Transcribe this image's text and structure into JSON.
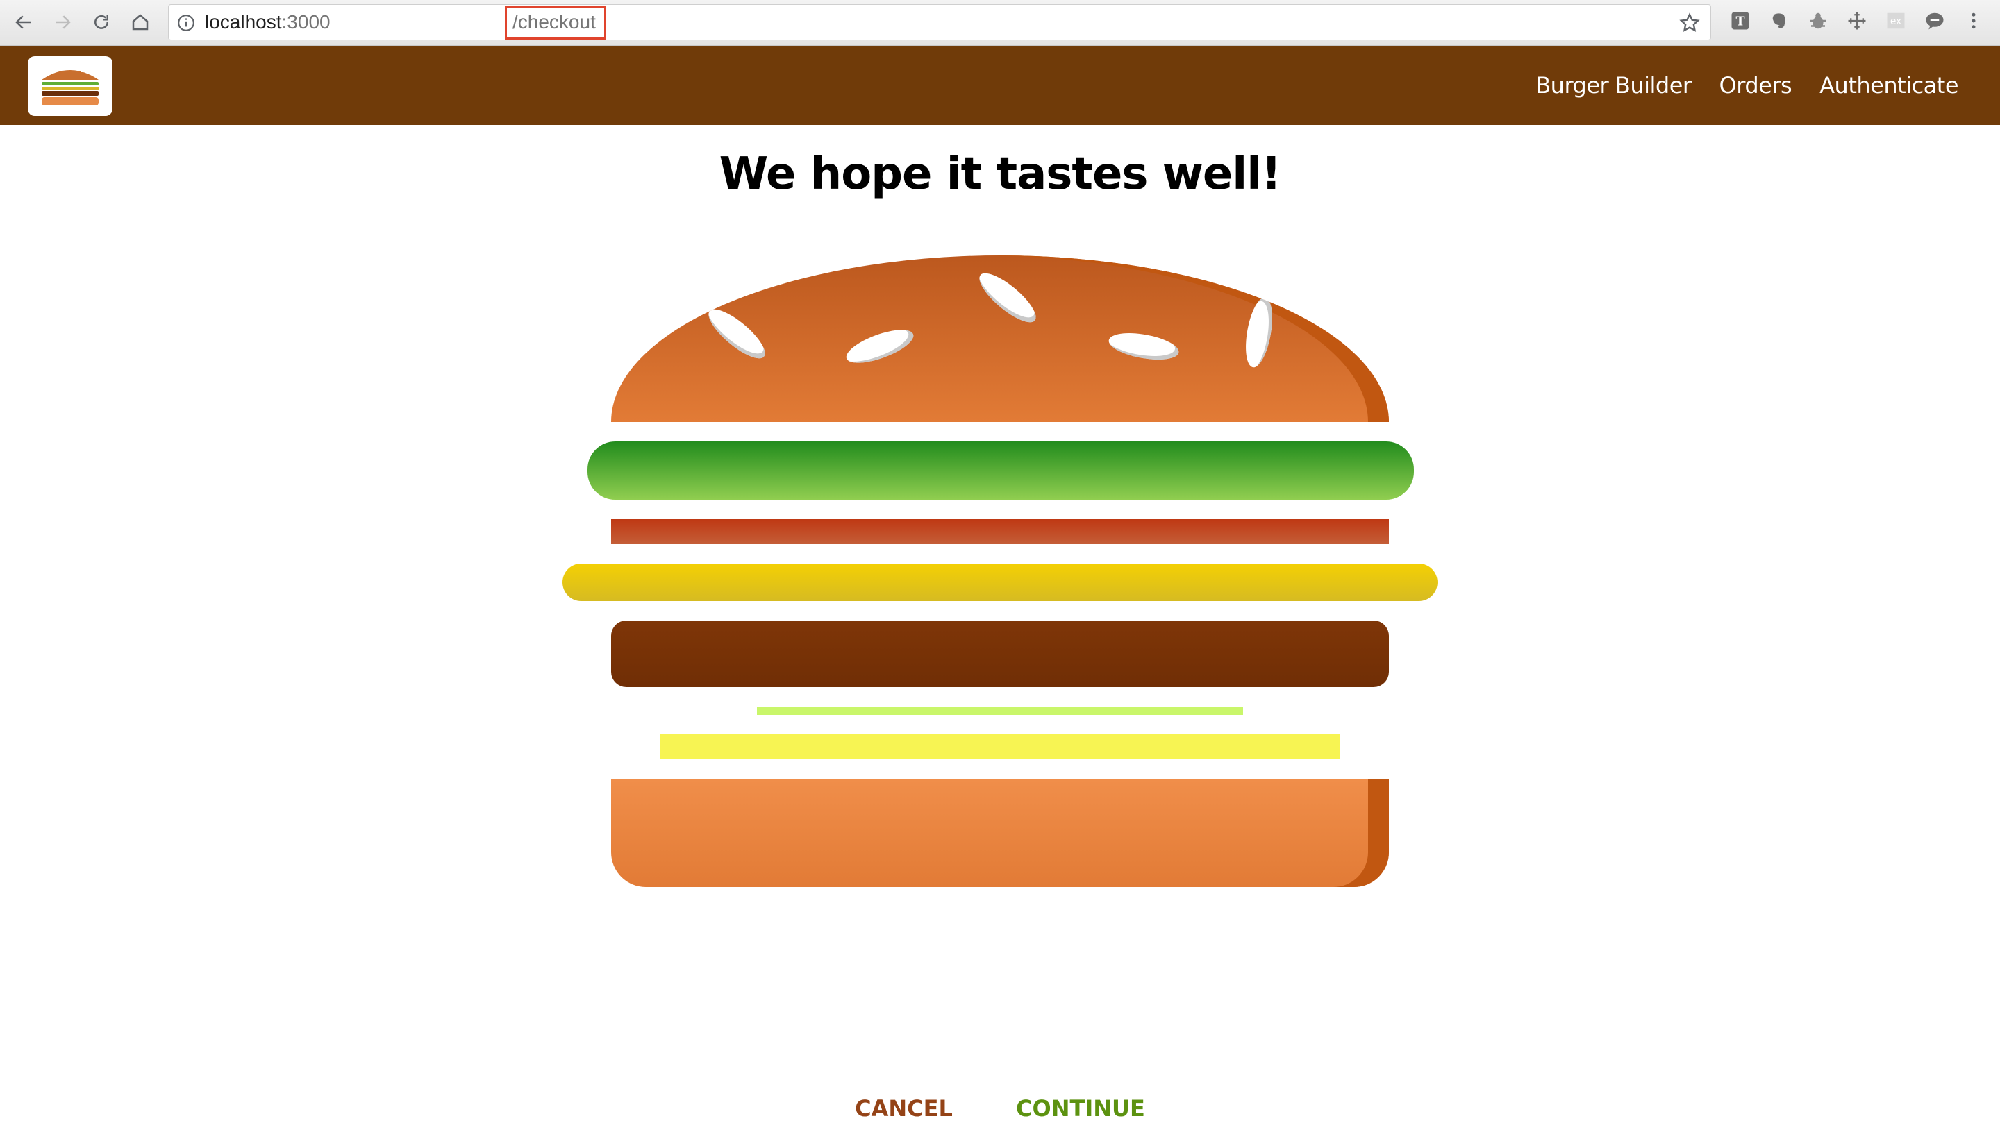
{
  "browser": {
    "url_host": "localhost",
    "url_port": ":3000",
    "url_path": "/checkout",
    "nav_icons": [
      "back-icon",
      "forward-icon",
      "reload-icon",
      "home-icon"
    ],
    "extension_icons": [
      "typora-icon",
      "evernote-icon",
      "bug-icon",
      "measure-icon",
      "ex-icon",
      "chat-icon",
      "menu-dots-icon"
    ]
  },
  "toolbar": {
    "logo": "burger-logo-icon",
    "nav_items": [
      {
        "label": "Burger Builder"
      },
      {
        "label": "Orders"
      },
      {
        "label": "Authenticate"
      }
    ],
    "background": "#703b09"
  },
  "checkout": {
    "heading": "We hope it tastes well!",
    "ingredients": [
      "bread-top",
      "salad",
      "bacon",
      "cheese",
      "meat",
      "pickle",
      "mustard",
      "bread-bottom"
    ],
    "cancel_label": "CANCEL",
    "continue_label": "CONTINUE",
    "cancel_color": "#944317",
    "continue_color": "#5c9210"
  }
}
